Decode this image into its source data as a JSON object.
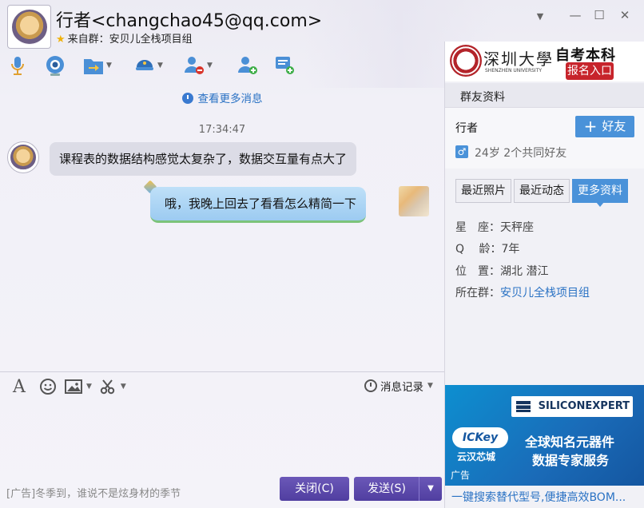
{
  "header": {
    "title": "行者<changchao45@qq.com>",
    "source_prefix": "来自群：",
    "source_group": "安贝儿全栈项目组",
    "controls": {
      "dropdown": "▼",
      "minimize": "—",
      "maximize": "☐",
      "close": "✕"
    }
  },
  "toolbar": {
    "icons": [
      "microphone-icon",
      "camera-icon",
      "file-transfer-icon",
      "remote-assist-icon",
      "remove-contact-icon",
      "add-contact-icon",
      "add-app-icon"
    ]
  },
  "chat": {
    "more_messages": "查看更多消息",
    "timestamp": "17:34:47",
    "messages": [
      {
        "side": "left",
        "text": "课程表的数据结构感觉太复杂了，数据交互量有点大了"
      },
      {
        "side": "right",
        "text": "哦，我晚上回去了看看怎么精简一下"
      }
    ]
  },
  "input": {
    "record_label": "消息记录",
    "ad_text": "[广告]冬季到，谁说不是炫身材的季节",
    "close_label": "关闭(C)",
    "send_label": "发送(S)"
  },
  "right_panel": {
    "banner": {
      "school_cn": "深圳大學",
      "school_en": "SHENZHEN UNIVERSITY",
      "headline": "自考本科",
      "cta": "报名入口"
    },
    "section_title": "群友资料",
    "profile": {
      "name": "行者",
      "add_friend": "好友",
      "gender_symbol": "♂",
      "age": "24岁",
      "mutual": "2个共同好友"
    },
    "tabs": [
      "最近照片",
      "最近动态",
      "更多资料"
    ],
    "active_tab": 2,
    "details": [
      {
        "label": "星　座：",
        "value": "天秤座"
      },
      {
        "label": "Q　 龄：",
        "value": "7年"
      },
      {
        "label": "位　置：",
        "value": "湖北 潜江"
      },
      {
        "label": "所在群：",
        "value": "安贝儿全栈项目组"
      }
    ],
    "ad": {
      "brand": "SILICONEXPERT",
      "ickey": "ICKey",
      "ickey_sub": "云汉芯城",
      "line1": "全球知名元器件",
      "line2": "数据专家服务",
      "tag": "广告",
      "link": "一键搜索替代型号,便捷高效BOM..."
    }
  },
  "colors": {
    "accent_blue": "#4a92d9",
    "purple_button": "#5a47aa",
    "link": "#2a72c4"
  }
}
